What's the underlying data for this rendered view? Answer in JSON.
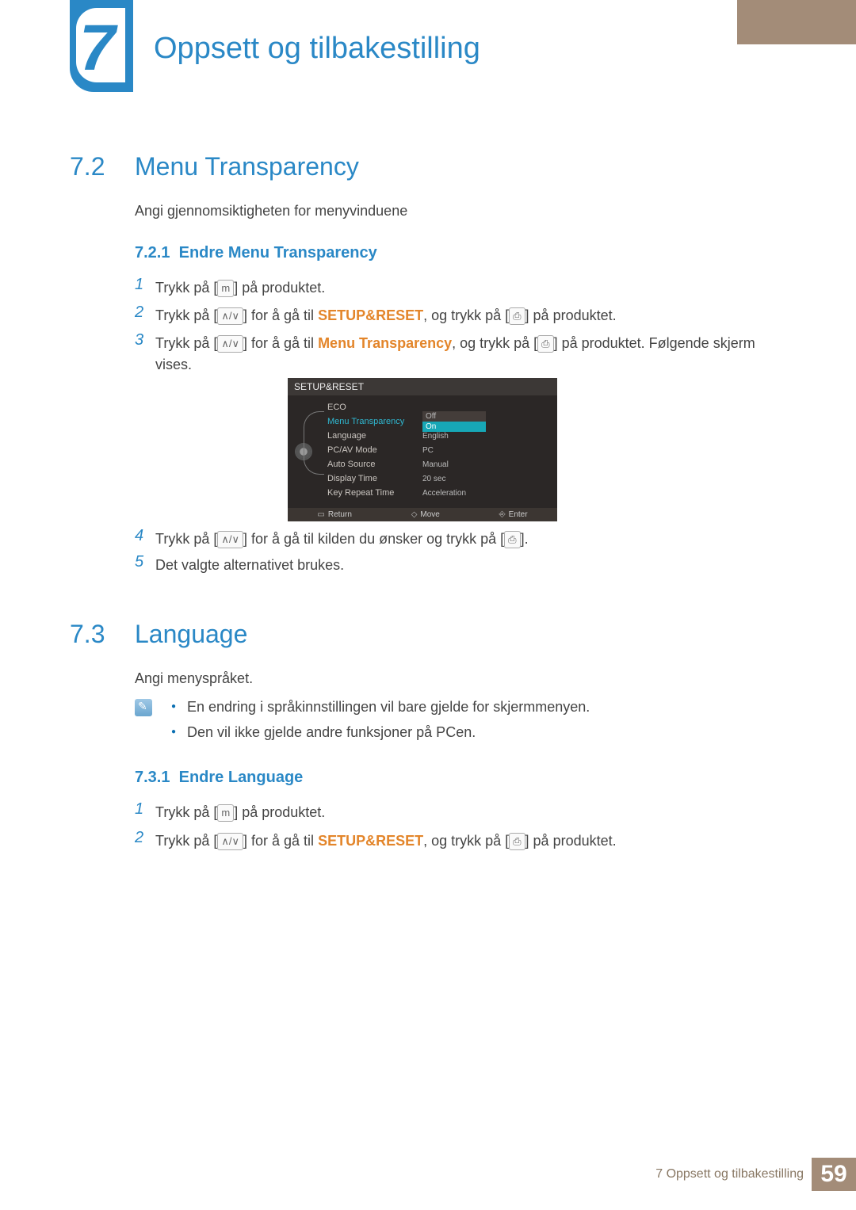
{
  "chapter": {
    "number": "7",
    "title": "Oppsett og tilbakestilling"
  },
  "section72": {
    "num": "7.2",
    "title": "Menu Transparency",
    "intro": "Angi gjennomsiktigheten for menyvinduene",
    "sub": {
      "num": "7.2.1",
      "title": "Endre Menu Transparency"
    },
    "steps": {
      "s1": "Trykk på [",
      "s1b": "] på produktet.",
      "s2a": "Trykk på [",
      "s2b": "] for å gå til ",
      "s2hl": "SETUP&RESET",
      "s2c": ", og trykk på [",
      "s2d": "] på produktet.",
      "s3a": "Trykk på [",
      "s3b": "] for å gå til ",
      "s3hl": "Menu Transparency",
      "s3c": ", og trykk på [",
      "s3d": "] på produktet. Følgende skjerm vises.",
      "s4a": "Trykk på [",
      "s4b": "] for å gå til kilden du ønsker og trykk på [",
      "s4c": "].",
      "s5": "Det valgte alternativet brukes."
    }
  },
  "osd": {
    "title": "SETUP&RESET",
    "rows": [
      {
        "label": "ECO",
        "value": ""
      },
      {
        "label": "Menu Transparency",
        "value": "",
        "active": true
      },
      {
        "label": "Language",
        "value": "English"
      },
      {
        "label": "PC/AV Mode",
        "value": "PC"
      },
      {
        "label": "Auto Source",
        "value": "Manual"
      },
      {
        "label": "Display Time",
        "value": "20 sec"
      },
      {
        "label": "Key Repeat Time",
        "value": "Acceleration"
      }
    ],
    "options": {
      "off": "Off",
      "on": "On"
    },
    "footer": {
      "ret": "Return",
      "move": "Move",
      "enter": "Enter"
    }
  },
  "section73": {
    "num": "7.3",
    "title": "Language",
    "intro": "Angi menyspråket.",
    "notes": {
      "n1": "En endring i språkinnstillingen vil bare gjelde for skjermmenyen.",
      "n2": "Den vil ikke gjelde andre funksjoner på PCen."
    },
    "sub": {
      "num": "7.3.1",
      "title": "Endre Language"
    },
    "steps": {
      "s1": "Trykk på [",
      "s1b": "] på produktet.",
      "s2a": "Trykk på [",
      "s2b": "] for å gå til ",
      "s2hl": "SETUP&RESET",
      "s2c": ", og trykk på [",
      "s2d": "] på produktet."
    }
  },
  "footer": {
    "text": "7 Oppsett og tilbakestilling",
    "page": "59"
  },
  "keys": {
    "m": "m",
    "updown": "∧/∨",
    "enter": "⎙"
  }
}
